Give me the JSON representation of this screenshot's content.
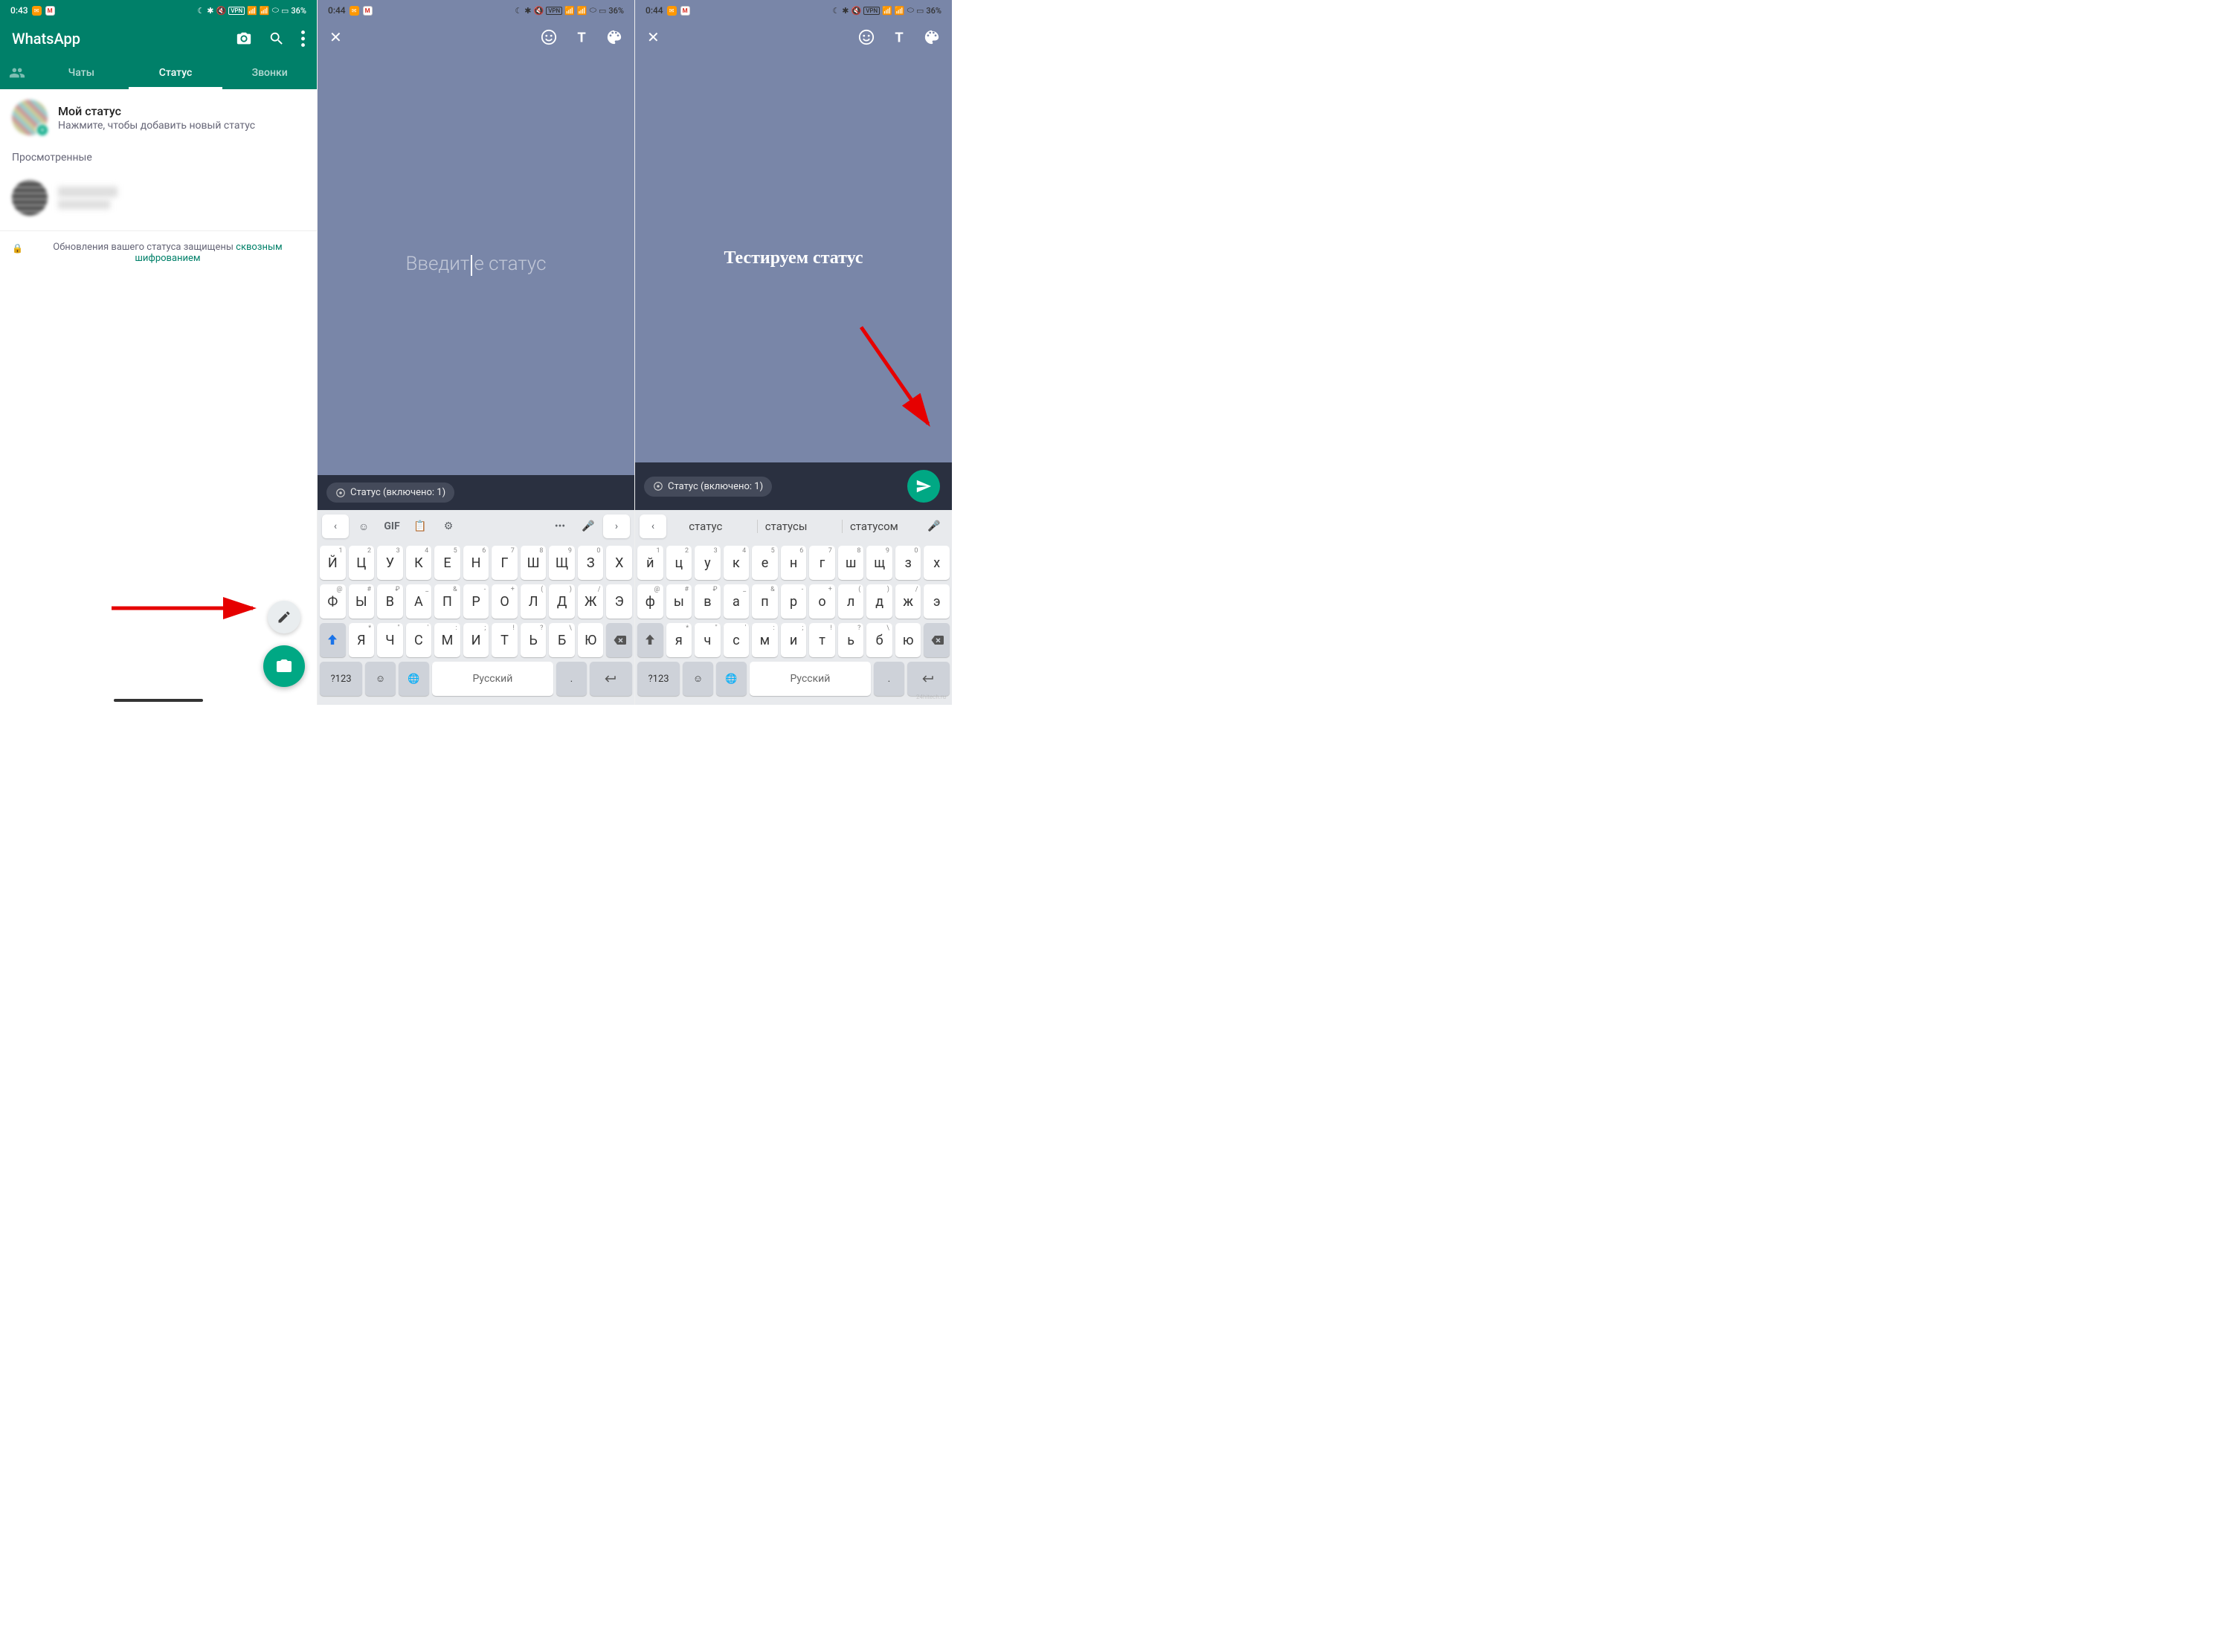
{
  "statusbar": {
    "time1": "0:43",
    "time2": "0:44",
    "time3": "0:44",
    "battery": "36%",
    "vpn": "VPN"
  },
  "wa": {
    "title": "WhatsApp",
    "tabs": {
      "chats": "Чаты",
      "status": "Статус",
      "calls": "Звонки"
    },
    "my_status": "Мой статус",
    "my_status_sub": "Нажмите, чтобы добавить новый статус",
    "viewed": "Просмотренные",
    "encryption_pre": "Обновления вашего статуса защищены ",
    "encryption_link": "сквозным шифрованием"
  },
  "composer": {
    "placeholder_left": "Введит",
    "placeholder_right": "е статус",
    "typed": "Тестируем статус",
    "chip": "Статус (включено: 1)"
  },
  "keyboard": {
    "gif": "GIF",
    "dots": "•••",
    "suggestions": [
      "статус",
      "статусы",
      "статусом"
    ],
    "row1": [
      {
        "k": "й",
        "s": "1"
      },
      {
        "k": "ц",
        "s": "2"
      },
      {
        "k": "у",
        "s": "3"
      },
      {
        "k": "к",
        "s": "4"
      },
      {
        "k": "е",
        "s": "5"
      },
      {
        "k": "н",
        "s": "6"
      },
      {
        "k": "г",
        "s": "7"
      },
      {
        "k": "ш",
        "s": "8"
      },
      {
        "k": "щ",
        "s": "9"
      },
      {
        "k": "з",
        "s": "0"
      },
      {
        "k": "х",
        "s": ""
      }
    ],
    "row2": [
      {
        "k": "ф",
        "s": "@"
      },
      {
        "k": "ы",
        "s": "#"
      },
      {
        "k": "в",
        "s": "₽"
      },
      {
        "k": "а",
        "s": "_"
      },
      {
        "k": "п",
        "s": "&"
      },
      {
        "k": "р",
        "s": "-"
      },
      {
        "k": "о",
        "s": "+"
      },
      {
        "k": "л",
        "s": "("
      },
      {
        "k": "д",
        "s": ")"
      },
      {
        "k": "ж",
        "s": "/"
      },
      {
        "k": "э",
        "s": ""
      }
    ],
    "row3": [
      {
        "k": "я",
        "s": "*"
      },
      {
        "k": "ч",
        "s": "\""
      },
      {
        "k": "с",
        "s": "'"
      },
      {
        "k": "м",
        "s": ":"
      },
      {
        "k": "и",
        "s": ";"
      },
      {
        "k": "т",
        "s": "!"
      },
      {
        "k": "ь",
        "s": "?"
      },
      {
        "k": "б",
        "s": "\\"
      },
      {
        "k": "ю",
        "s": ""
      }
    ],
    "numkey": "?123",
    "comma": ",",
    "space": "Русский",
    "period": "."
  },
  "watermark": "24hitech.ru"
}
